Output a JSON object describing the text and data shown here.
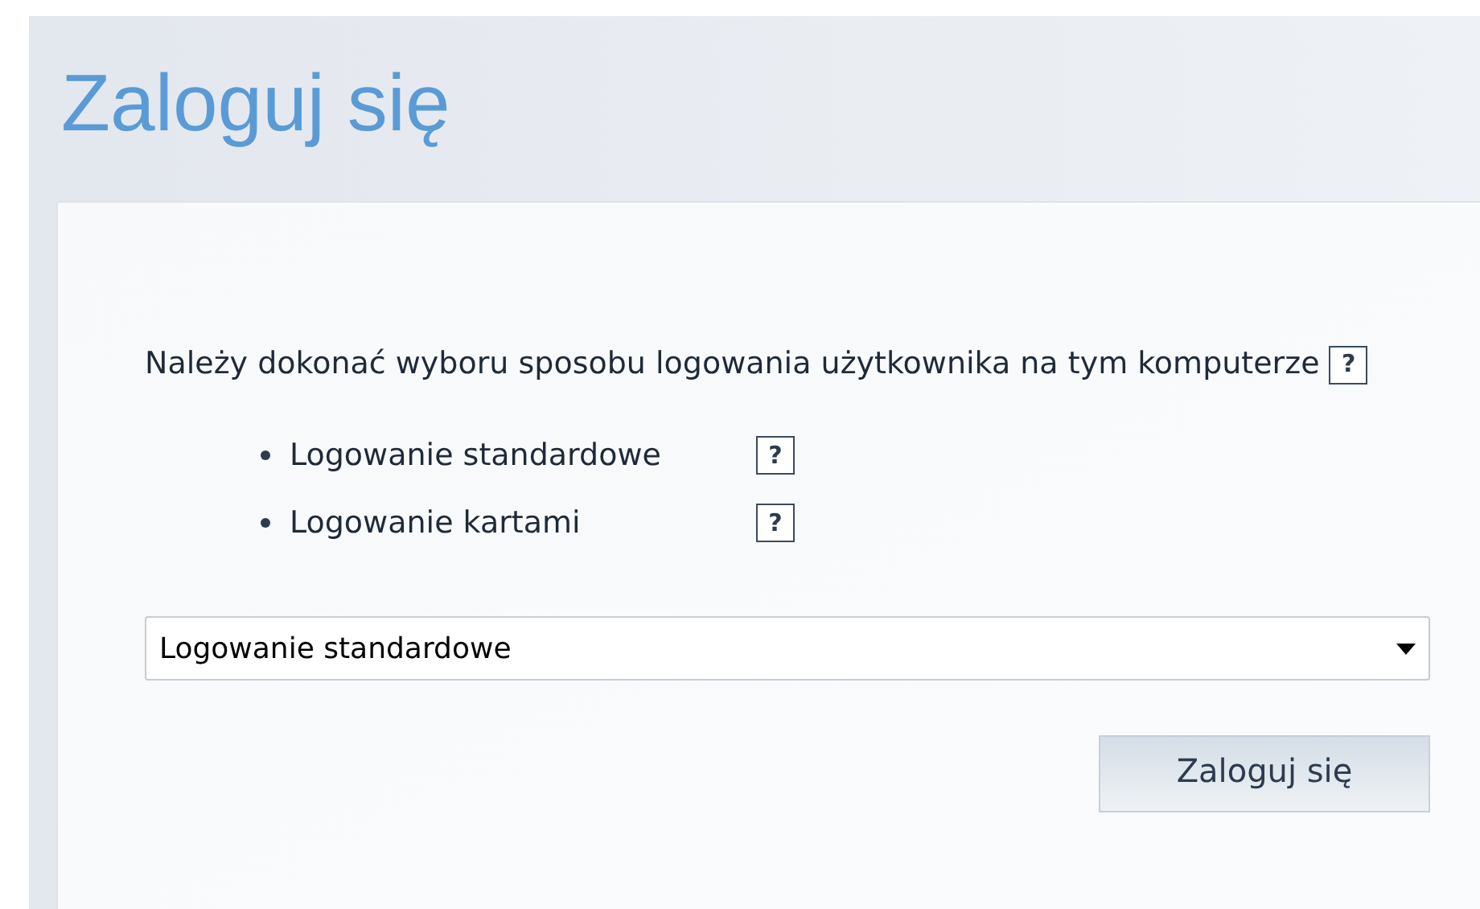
{
  "title": "Zaloguj się",
  "intro": "Należy dokonać wyboru sposobu logowania użytkownika na tym komputerze",
  "intro_help": "?",
  "options": [
    {
      "label": "Logowanie standardowe",
      "help": "?"
    },
    {
      "label": "Logowanie kartami",
      "help": "?"
    }
  ],
  "select": {
    "value": "Logowanie standardowe"
  },
  "button": "Zaloguj się"
}
